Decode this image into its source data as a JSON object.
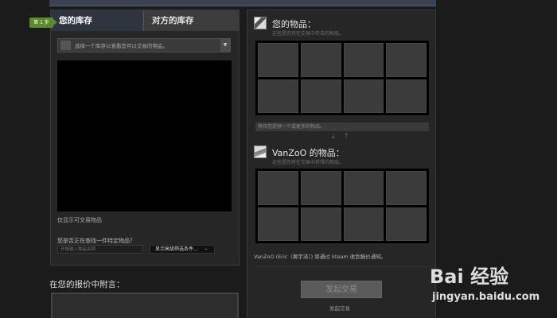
{
  "left_panel": {
    "tabs": [
      {
        "label": "您的库存"
      },
      {
        "label": "对方的库存"
      }
    ],
    "step_badge": "第 1 步",
    "inventory_select": {
      "placeholder": "选择一个库存以查看您可以交易的物品。"
    },
    "tradable_only": "仅显示可交易物品",
    "search_question": "您是否正在查找一件特定物品？",
    "search_placeholder": "开始输入物品名称",
    "filter_button": "显示高级筛选条件...",
    "chevron": "⌄"
  },
  "note": {
    "title": "在您的报价中附言："
  },
  "right_panel": {
    "my_items": {
      "title": "您的物品：",
      "subtitle": "这些是您将在交易中失去的物品。",
      "slots": 8
    },
    "hint": "等待您提供一个或更多的物品。",
    "swap_arrows": "⇣ ⇡",
    "their_items": {
      "title": "VanZoO 的物品：",
      "subtitle": "这些是您将在交易中获得的物品。",
      "slots": 8
    },
    "notify": "VanZoO (Eric（黄宇泽）) 将通过 Steam 收到报价通知。",
    "trade_button": "发起交易",
    "trade_caption": "发起交易"
  },
  "watermark": {
    "logo": "Bai 经验",
    "paw": "🐾",
    "url": "jingyan.baidu.com"
  }
}
